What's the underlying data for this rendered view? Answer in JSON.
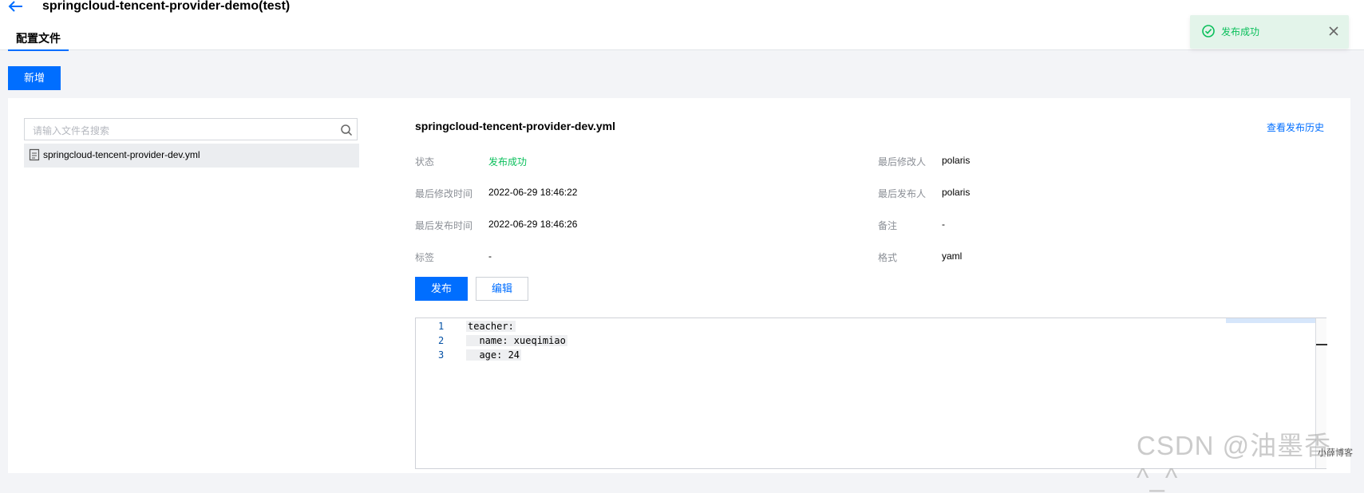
{
  "header": {
    "title": "springcloud-tencent-provider-demo(test)",
    "tab_label": "配置文件"
  },
  "toast": {
    "message": "发布成功"
  },
  "toolbar": {
    "add_label": "新增"
  },
  "file_list": {
    "search_placeholder": "请输入文件名搜索",
    "items": [
      {
        "name": "springcloud-tencent-provider-dev.yml"
      }
    ]
  },
  "detail": {
    "file_name": "springcloud-tencent-provider-dev.yml",
    "history_link": "查看发布历史",
    "fields": {
      "status_label": "状态",
      "status_value": "发布成功",
      "modified_by_label": "最后修改人",
      "modified_by_value": "polaris",
      "modified_time_label": "最后修改时间",
      "modified_time_value": "2022-06-29 18:46:22",
      "published_by_label": "最后发布人",
      "published_by_value": "polaris",
      "published_time_label": "最后发布时间",
      "published_time_value": "2022-06-29 18:46:26",
      "remark_label": "备注",
      "remark_value": "-",
      "tags_label": "标签",
      "tags_value": "-",
      "format_label": "格式",
      "format_value": "yaml"
    },
    "publish_label": "发布",
    "edit_label": "编辑"
  },
  "editor": {
    "lines": [
      {
        "no": "1",
        "text": "teacher:"
      },
      {
        "no": "2",
        "text": "  name: xueqimiao"
      },
      {
        "no": "3",
        "text": "  age: 24"
      }
    ]
  },
  "watermark": {
    "text": "CSDN @油墨香^_^",
    "corner_text": "小薛博客"
  },
  "colors": {
    "primary": "#006eff",
    "success": "#0abf5b",
    "toast_bg": "#e3f4ea"
  }
}
